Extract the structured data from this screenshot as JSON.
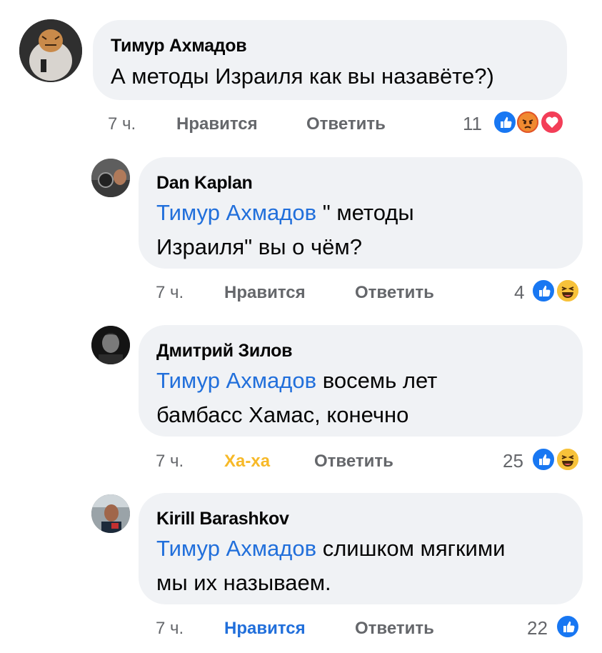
{
  "comments": [
    {
      "author": "Тимур Ахмадов",
      "lines": [
        {
          "mention": "",
          "text": "А методы Израиля как вы назавёте?)"
        }
      ],
      "time": "7 ч.",
      "like": "Нравится",
      "reply": "Ответить",
      "count": "11",
      "reactions": [
        "like",
        "angry",
        "love"
      ]
    },
    {
      "author": "Dan Kaplan",
      "lines": [
        {
          "mention": "Тимур Ахмадов",
          "text": " \" методы"
        },
        {
          "mention": "",
          "text": "Израиля\" вы о чём?"
        }
      ],
      "time": "7 ч.",
      "like": "Нравится",
      "reply": "Ответить",
      "count": "4",
      "reactions": [
        "like",
        "haha"
      ]
    },
    {
      "author": "Дмитрий Зилов",
      "lines": [
        {
          "mention": "Тимур Ахмадов",
          "text": " восемь лет"
        },
        {
          "mention": "",
          "text": "бамбасс Хамас, конечно"
        }
      ],
      "time": "7 ч.",
      "like": "Ха-ха",
      "reply": "Ответить",
      "count": "25",
      "reactions": [
        "like",
        "haha"
      ]
    },
    {
      "author": "Kirill Barashkov",
      "lines": [
        {
          "mention": "Тимур Ахмадов",
          "text": " слишком мягкими"
        },
        {
          "mention": "",
          "text": "мы их называем."
        }
      ],
      "time": "7 ч.",
      "like": "Нравится",
      "reply": "Ответить",
      "count": "22",
      "reactions": [
        "like"
      ]
    }
  ],
  "colors": {
    "bubble": "#f0f2f5",
    "mention": "#216fdb",
    "meta": "#65676b",
    "like_blue": "#1877f2",
    "haha_yellow": "#f7b928",
    "love_red": "#f33e58",
    "angry_orange": "#e9710f"
  }
}
